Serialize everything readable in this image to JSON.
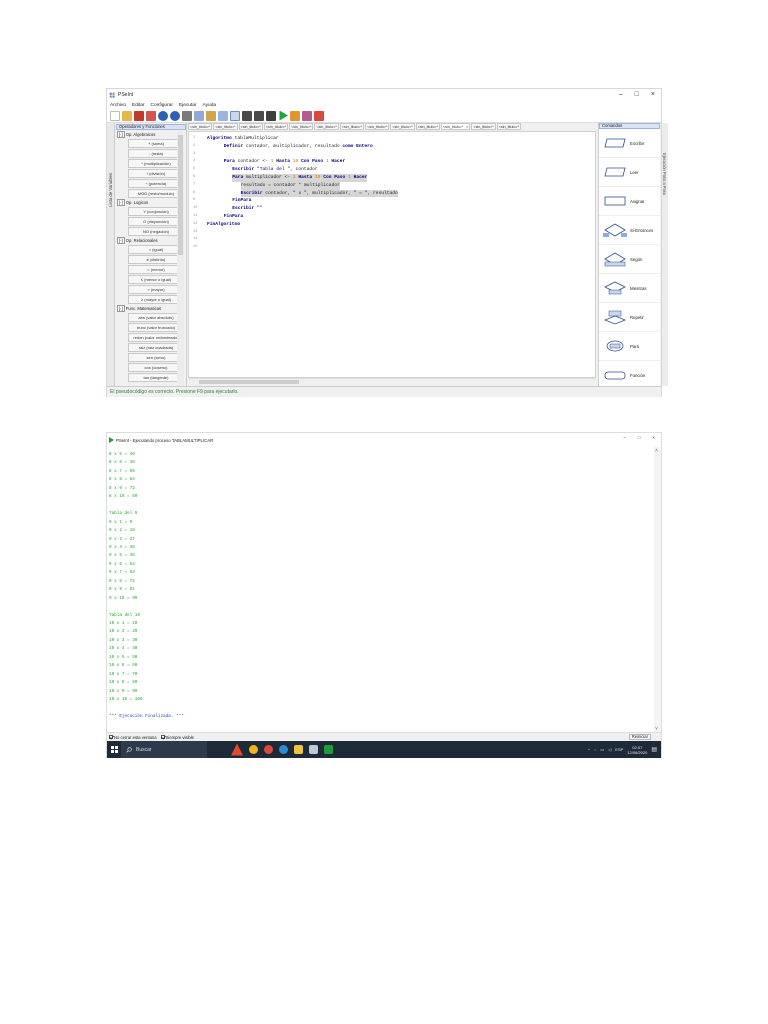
{
  "editor_window": {
    "title": "PSeInt",
    "controls": [
      "–",
      "□",
      "×"
    ],
    "menu": [
      "Archivo",
      "Editar",
      "Configurar",
      "Ejecutar",
      "Ayuda"
    ],
    "left_panel": {
      "vertical_tab": "Lista de Variables",
      "header": "Operadores y Funciones",
      "groups": [
        {
          "toggle": "[-]",
          "label": "Op. Algebraicos",
          "items": [
            "+ (suma)",
            "- (resta)",
            "* (multiplicación)",
            "/ (división)",
            "^ (potencia)",
            "MOD (resto/modulo)"
          ]
        },
        {
          "toggle": "[-]",
          "label": "Op. Logicos",
          "items": [
            "Y (conjunción)",
            "O (disyunción)",
            "NO (negación)"
          ]
        },
        {
          "toggle": "[-]",
          "label": "Op. Relacionales",
          "items": [
            "= (igual)",
            "≠ (distinto)",
            "< (menor)",
            "≤ (menor o igual)",
            "> (mayor)",
            "≥ (mayor o igual)"
          ]
        },
        {
          "toggle": "[-]",
          "label": "Func. Matematicas",
          "items": [
            "abs (valor absoluto)",
            "trunc (valor truncado)",
            "redon (valor redondeado)",
            "raiz (raiz cuadrada)",
            "sen (seno)",
            "cos (coseno)",
            "tan (tangente)"
          ]
        }
      ]
    },
    "tabs": [
      "<sin_titulo>*",
      "<sin_titulo>*",
      "<sin_titulo>*",
      "<sin_titulo>*",
      "<sin_titulo>*",
      "<sin_titulo>*",
      "<sin_titulo>*",
      "<sin_titulo>*",
      "<sin_titulo>*",
      "<sin_titulo>*",
      "<sin_titulo>*",
      "<sin_titulo>*"
    ],
    "active_tab": "<sin_titulo>*",
    "active_tab_close": "×",
    "right_panel": {
      "header": "Comandos",
      "vertical_tab": "Ejecución Paso a Paso",
      "commands": [
        "Escribir",
        "Leer",
        "Asignar",
        "Si-Entonces",
        "Según",
        "Mientras",
        "Repetir",
        "Para",
        "Función"
      ]
    },
    "status": "El pseudocódigo es correcto. Presione F9 para ejecutarlo.",
    "colors": {
      "status_text": "#2e7d32",
      "keyword": "#00007f",
      "number": "#e07000",
      "highlight": "#d6d6d6"
    }
  },
  "code_lines": [
    {
      "n": "1",
      "text": "Algoritmo tablaMultiplicar"
    },
    {
      "n": "2",
      "text": "Definir contador, multiplicador, resultado como Entero"
    },
    {
      "n": "3",
      "text": ""
    },
    {
      "n": "4",
      "text": "Para contador <- 1 Hasta 10 Con Paso 1 Hacer"
    },
    {
      "n": "5",
      "text": "Escribir \"Tabla del \", contador"
    },
    {
      "n": "6",
      "text": "Para multiplicador <- 1 Hasta 10 Con Paso 1 Hacer"
    },
    {
      "n": "7",
      "text": "resultado = contador * multiplicador"
    },
    {
      "n": "8",
      "text": "Escribir contador, \" x \", multiplicador, \" = \", resultado"
    },
    {
      "n": "9",
      "text": "FinPara"
    },
    {
      "n": "10",
      "text": "Escribir \"\""
    },
    {
      "n": "11",
      "text": "FinPara"
    },
    {
      "n": "12",
      "text": "FinAlgoritmo"
    },
    {
      "n": "13",
      "text": ""
    },
    {
      "n": "14",
      "text": ""
    },
    {
      "n": "15",
      "text": ""
    }
  ],
  "console_window": {
    "title": "PSeInt - Ejecutando proceso TABLAMULTIPLICAR",
    "controls": [
      "–",
      "□",
      "×"
    ],
    "lines": [
      "8 x 5 = 40",
      "8 x 6 = 48",
      "8 x 7 = 56",
      "8 x 8 = 64",
      "8 x 9 = 72",
      "8 x 10 = 80",
      "",
      "Tabla del 9",
      "9 x 1 = 9",
      "9 x 2 = 18",
      "9 x 3 = 27",
      "9 x 4 = 36",
      "9 x 5 = 45",
      "9 x 6 = 54",
      "9 x 7 = 63",
      "9 x 8 = 72",
      "9 x 9 = 81",
      "9 x 10 = 90",
      "",
      "Tabla del 10",
      "10 x 1 = 10",
      "10 x 2 = 20",
      "10 x 3 = 30",
      "10 x 4 = 40",
      "10 x 5 = 50",
      "10 x 6 = 60",
      "10 x 7 = 70",
      "10 x 8 = 80",
      "10 x 9 = 90",
      "10 x 10 = 100",
      "",
      "*** Ejecución Finalizada. ***"
    ],
    "no_close_label": "No cerrar esta ventana",
    "no_close_checked": true,
    "always_visible_label": "Siempre visible",
    "always_visible_checked": true,
    "restart_label": "Reiniciar",
    "colors": {
      "output": "#25a52e",
      "finished": "#1d4fb0"
    }
  },
  "taskbar": {
    "search_placeholder": "Buscar",
    "tray_icons": [
      "^",
      "wifi",
      "battery",
      "volume"
    ],
    "language": "ESP",
    "time": "02:07",
    "date": "12/06/2020"
  }
}
